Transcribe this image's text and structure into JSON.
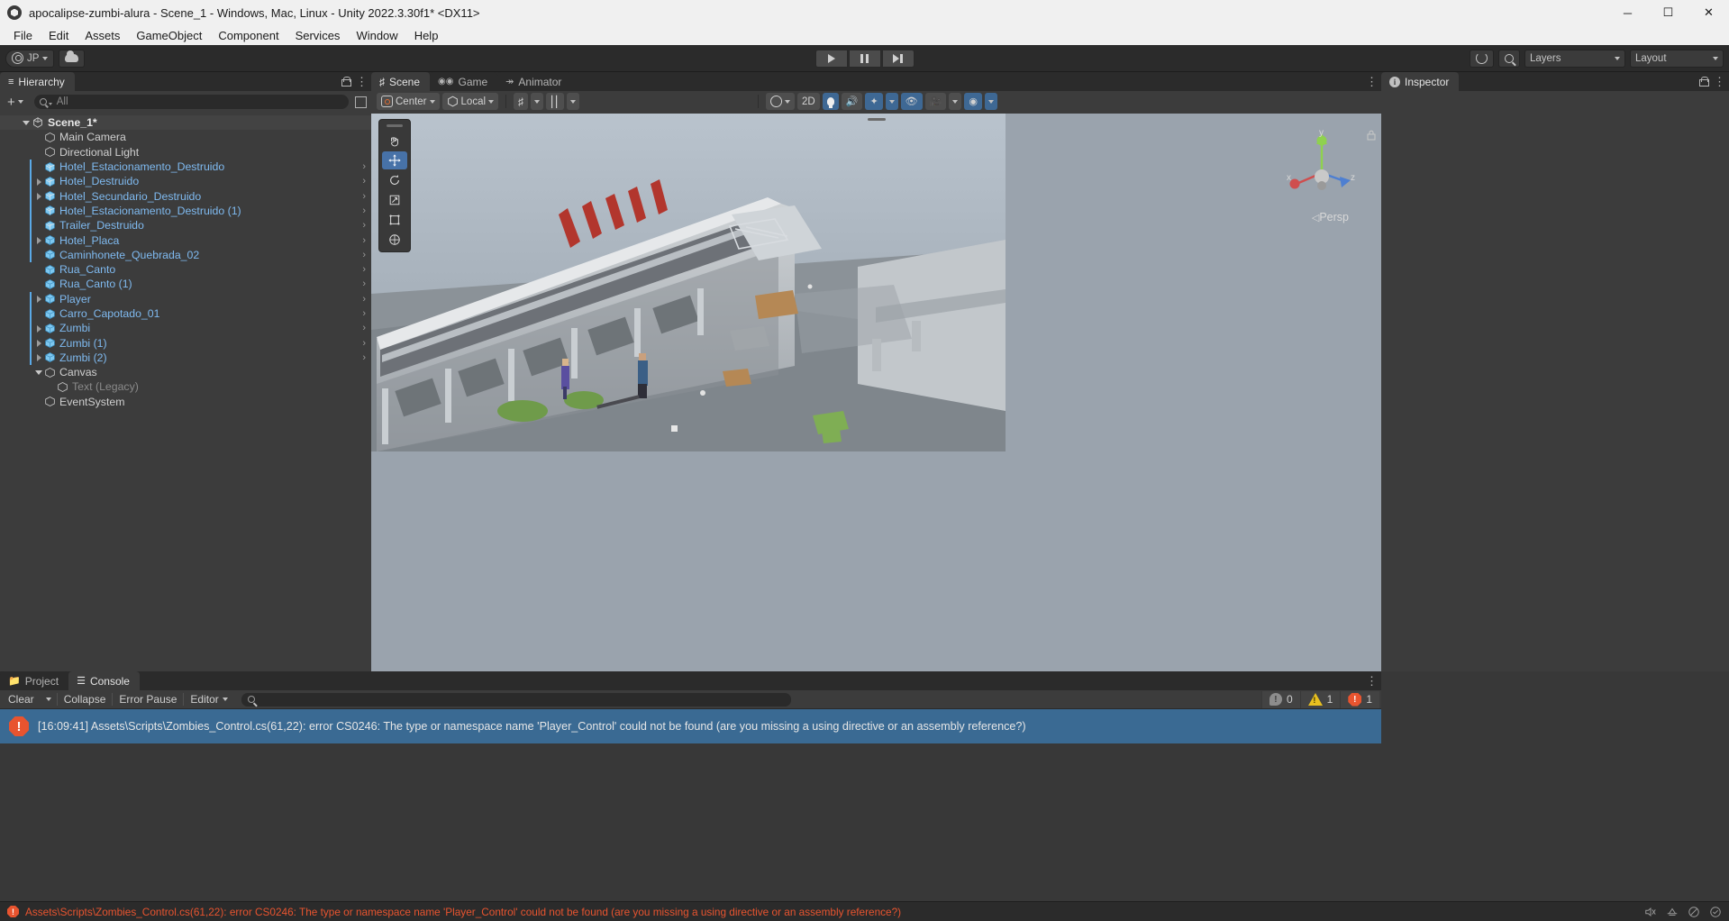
{
  "window": {
    "title": "apocalipse-zumbi-alura - Scene_1 - Windows, Mac, Linux - Unity 2022.3.30f1* <DX11>",
    "minimize": "─",
    "maximize": "☐",
    "close": "✕"
  },
  "menubar": {
    "items": [
      "File",
      "Edit",
      "Assets",
      "GameObject",
      "Component",
      "Services",
      "Window",
      "Help"
    ]
  },
  "toolbar": {
    "account_label": "JP",
    "cloud_icon": "cloud-icon",
    "play_icon": "play-icon",
    "pause_icon": "pause-icon",
    "step_icon": "step-icon",
    "history_icon": "undo-history-icon",
    "search_icon": "search-icon",
    "layers_label": "Layers",
    "layout_label": "Layout"
  },
  "hierarchy": {
    "tab_label": "Hierarchy",
    "add_label": "+",
    "search_placeholder": "All",
    "items": [
      {
        "label": "Scene_1*",
        "depth": 0,
        "twisty": "open",
        "icon": "unity-scene-icon",
        "style": "root",
        "prefab_bar": false,
        "more": false
      },
      {
        "label": "Main Camera",
        "depth": 1,
        "twisty": "none",
        "icon": "gameobject-icon",
        "style": "normal",
        "prefab_bar": false,
        "more": false
      },
      {
        "label": "Directional Light",
        "depth": 1,
        "twisty": "none",
        "icon": "gameobject-icon",
        "style": "normal",
        "prefab_bar": false,
        "more": false
      },
      {
        "label": "Hotel_Estacionamento_Destruido",
        "depth": 1,
        "twisty": "none",
        "icon": "prefab-variant-icon",
        "style": "prefab",
        "prefab_bar": true,
        "more": true
      },
      {
        "label": "Hotel_Destruido",
        "depth": 1,
        "twisty": "closed",
        "icon": "prefab-variant-icon",
        "style": "prefab",
        "prefab_bar": true,
        "more": true
      },
      {
        "label": "Hotel_Secundario_Destruido",
        "depth": 1,
        "twisty": "closed",
        "icon": "prefab-variant-icon",
        "style": "prefab",
        "prefab_bar": true,
        "more": true
      },
      {
        "label": "Hotel_Estacionamento_Destruido (1)",
        "depth": 1,
        "twisty": "none",
        "icon": "prefab-variant-icon",
        "style": "prefab",
        "prefab_bar": true,
        "more": true
      },
      {
        "label": "Trailer_Destruido",
        "depth": 1,
        "twisty": "none",
        "icon": "prefab-variant-icon",
        "style": "prefab",
        "prefab_bar": true,
        "more": true
      },
      {
        "label": "Hotel_Placa",
        "depth": 1,
        "twisty": "closed",
        "icon": "prefab-icon",
        "style": "prefab",
        "prefab_bar": true,
        "more": true
      },
      {
        "label": "Caminhonete_Quebrada_02",
        "depth": 1,
        "twisty": "none",
        "icon": "prefab-icon",
        "style": "prefab",
        "prefab_bar": true,
        "more": true
      },
      {
        "label": "Rua_Canto",
        "depth": 1,
        "twisty": "none",
        "icon": "prefab-icon",
        "style": "prefab",
        "prefab_bar": false,
        "more": true
      },
      {
        "label": "Rua_Canto (1)",
        "depth": 1,
        "twisty": "none",
        "icon": "prefab-icon",
        "style": "prefab",
        "prefab_bar": false,
        "more": true
      },
      {
        "label": "Player",
        "depth": 1,
        "twisty": "closed",
        "icon": "prefab-icon",
        "style": "prefab",
        "prefab_bar": true,
        "more": true
      },
      {
        "label": "Carro_Capotado_01",
        "depth": 1,
        "twisty": "none",
        "icon": "prefab-icon",
        "style": "prefab",
        "prefab_bar": true,
        "more": true
      },
      {
        "label": "Zumbi",
        "depth": 1,
        "twisty": "closed",
        "icon": "prefab-icon",
        "style": "prefab",
        "prefab_bar": true,
        "more": true
      },
      {
        "label": "Zumbi (1)",
        "depth": 1,
        "twisty": "closed",
        "icon": "prefab-icon",
        "style": "prefab",
        "prefab_bar": true,
        "more": true
      },
      {
        "label": "Zumbi (2)",
        "depth": 1,
        "twisty": "closed",
        "icon": "prefab-icon",
        "style": "prefab",
        "prefab_bar": true,
        "more": true
      },
      {
        "label": "Canvas",
        "depth": 1,
        "twisty": "open",
        "icon": "gameobject-icon",
        "style": "normal",
        "prefab_bar": false,
        "more": false
      },
      {
        "label": "Text (Legacy)",
        "depth": 2,
        "twisty": "none",
        "icon": "gameobject-icon",
        "style": "disabled",
        "prefab_bar": false,
        "more": false
      },
      {
        "label": "EventSystem",
        "depth": 1,
        "twisty": "none",
        "icon": "gameobject-icon",
        "style": "normal",
        "prefab_bar": false,
        "more": false
      }
    ]
  },
  "scene_panel": {
    "tabs": [
      {
        "label": "Scene",
        "icon": "scene-hash-icon",
        "active": true
      },
      {
        "label": "Game",
        "icon": "gamepad-icon",
        "active": false
      },
      {
        "label": "Animator",
        "icon": "animator-icon",
        "active": false
      }
    ],
    "toolbar": {
      "pivot_label": "Center",
      "space_label": "Local",
      "grid_icon": "grid-snap-icon",
      "snap_icon": "snap-increment-icon",
      "lighting_icon": "scene-lighting-sphere-icon",
      "twod_label": "2D",
      "light_icon": "light-bulb-icon",
      "audio_icon": "audio-mute-icon",
      "fx_icon": "effects-icon",
      "hidden_icon": "hidden-objects-icon",
      "camera_icon": "scene-camera-icon",
      "gizmos_icon": "gizmos-icon"
    },
    "tools": [
      "hand-tool",
      "move-tool",
      "rotate-tool",
      "scale-tool",
      "rect-tool",
      "transform-tool"
    ],
    "active_tool": "move-tool",
    "gizmo": {
      "x": "x",
      "y": "y",
      "z": "z",
      "mode": "Persp"
    }
  },
  "inspector": {
    "tab_label": "Inspector",
    "icon": "info-icon"
  },
  "console_panel": {
    "tabs": [
      {
        "label": "Project",
        "icon": "folder-icon",
        "active": false
      },
      {
        "label": "Console",
        "icon": "console-icon",
        "active": true
      }
    ],
    "toolbar": {
      "clear_label": "Clear",
      "collapse_label": "Collapse",
      "error_pause_label": "Error Pause",
      "editor_label": "Editor",
      "search_placeholder": ""
    },
    "counts": {
      "info": "0",
      "warning": "1",
      "error": "1"
    },
    "messages": [
      {
        "text": "[16:09:41] Assets\\Scripts\\Zombies_Control.cs(61,22): error CS0246: The type or namespace name 'Player_Control' could not be found (are you missing a using directive or an assembly reference?)",
        "type": "error",
        "selected": true
      }
    ]
  },
  "statusbar": {
    "message": "Assets\\Scripts\\Zombies_Control.cs(61,22): error CS0246: The type or namespace name 'Player_Control' could not be found (are you missing a using directive or an assembly reference?)",
    "icons": [
      "audio-mute-icon",
      "collab-icon",
      "mute-icon",
      "progress-icon"
    ]
  },
  "colors": {
    "accent_blue": "#5aa9e6",
    "prefab_blue": "#7fbaf0",
    "error_red": "#e8542f",
    "warning_yellow": "#e8c020",
    "selection_blue": "#3a6a93"
  }
}
